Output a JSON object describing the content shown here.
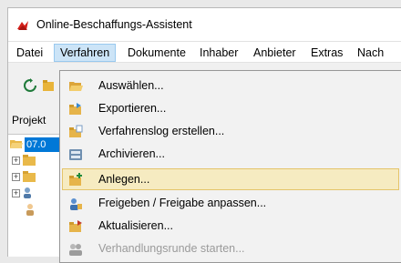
{
  "window": {
    "title": "Online-Beschaffungs-Assistent"
  },
  "menubar": {
    "items": [
      {
        "label": "Datei"
      },
      {
        "label": "Verfahren"
      },
      {
        "label": "Dokumente"
      },
      {
        "label": "Inhaber"
      },
      {
        "label": "Anbieter"
      },
      {
        "label": "Extras"
      },
      {
        "label": "Nach"
      }
    ],
    "active": "Verfahren"
  },
  "toolbar": {
    "icons": [
      "refresh-icon",
      "folder-icon"
    ]
  },
  "project": {
    "label": "Projekt"
  },
  "tree": {
    "selected_text": "07.0"
  },
  "menu_verfahren": {
    "items": [
      {
        "label": "Auswählen...",
        "icon": "open-folder-icon",
        "enabled": true,
        "highlighted": false
      },
      {
        "label": "Exportieren...",
        "icon": "export-folder-icon",
        "enabled": true,
        "highlighted": false
      },
      {
        "label": "Verfahrenslog erstellen...",
        "icon": "log-folder-icon",
        "enabled": true,
        "highlighted": false
      },
      {
        "label": "Archivieren...",
        "icon": "archive-icon",
        "enabled": true,
        "highlighted": false
      },
      {
        "label": "Anlegen...",
        "icon": "new-folder-icon",
        "enabled": true,
        "highlighted": true
      },
      {
        "label": "Freigeben / Freigabe anpassen...",
        "icon": "share-icon",
        "enabled": true,
        "highlighted": false
      },
      {
        "label": "Aktualisieren...",
        "icon": "update-icon",
        "enabled": true,
        "highlighted": false
      },
      {
        "label": "Verhandlungsrunde starten...",
        "icon": "negotiation-icon",
        "enabled": false,
        "highlighted": false
      }
    ]
  },
  "colors": {
    "menu_highlight": "#f6ebc1",
    "menu_highlight_border": "#e4c46a",
    "menubar_active": "#cce4f7",
    "tree_selection": "#0078d7"
  }
}
